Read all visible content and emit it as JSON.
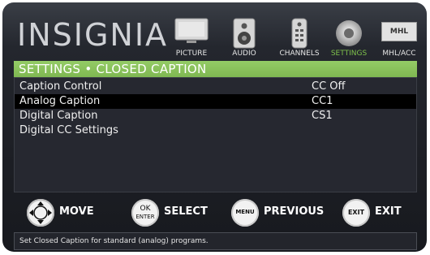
{
  "brand": "INSIGNIA",
  "menu": [
    {
      "key": "picture",
      "label": "PICTURE",
      "icon": "tv-icon"
    },
    {
      "key": "audio",
      "label": "AUDIO",
      "icon": "speaker-icon"
    },
    {
      "key": "channels",
      "label": "CHANNELS",
      "icon": "remote-icon"
    },
    {
      "key": "settings",
      "label": "SETTINGS",
      "icon": "gear-icon",
      "active": true
    },
    {
      "key": "mhl",
      "label": "MHL/ACC",
      "icon": "mhl-icon",
      "icon_text": "MHL"
    }
  ],
  "title": "SETTINGS • CLOSED CAPTION",
  "items": [
    {
      "label": "Caption Control",
      "value": "CC Off"
    },
    {
      "label": "Analog Caption",
      "value": "CC1",
      "selected": true
    },
    {
      "label": "Digital Caption",
      "value": "CS1"
    },
    {
      "label": "Digital CC Settings",
      "value": ""
    }
  ],
  "footer": {
    "move": {
      "label": "MOVE"
    },
    "select": {
      "label": "SELECT",
      "key_top": "OK",
      "key_bottom": "ENTER"
    },
    "previous": {
      "label": "PREVIOUS",
      "key": "MENU"
    },
    "exit": {
      "label": "EXIT",
      "key": "EXIT"
    }
  },
  "status": "Set Closed Caption for standard (analog) programs.",
  "colors": {
    "accent": "#7ec04b",
    "titlebar": "#8cc45e",
    "selected_row": "#000000"
  }
}
